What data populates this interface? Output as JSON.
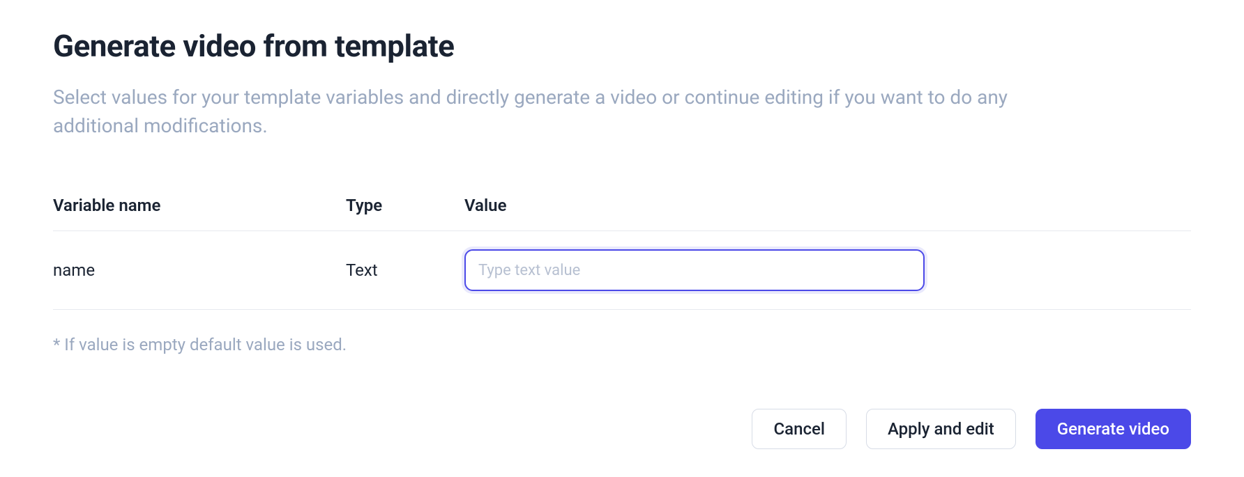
{
  "header": {
    "title": "Generate video from template",
    "description": "Select values for your template variables and directly generate a video or continue editing if you want to do any additional modifications."
  },
  "table": {
    "columns": {
      "variable_name": "Variable name",
      "type": "Type",
      "value": "Value"
    },
    "rows": [
      {
        "name": "name",
        "type": "Text",
        "value": "",
        "placeholder": "Type text value"
      }
    ]
  },
  "footnote": "* If value is empty default value is used.",
  "buttons": {
    "cancel": "Cancel",
    "apply_edit": "Apply and edit",
    "generate": "Generate video"
  }
}
